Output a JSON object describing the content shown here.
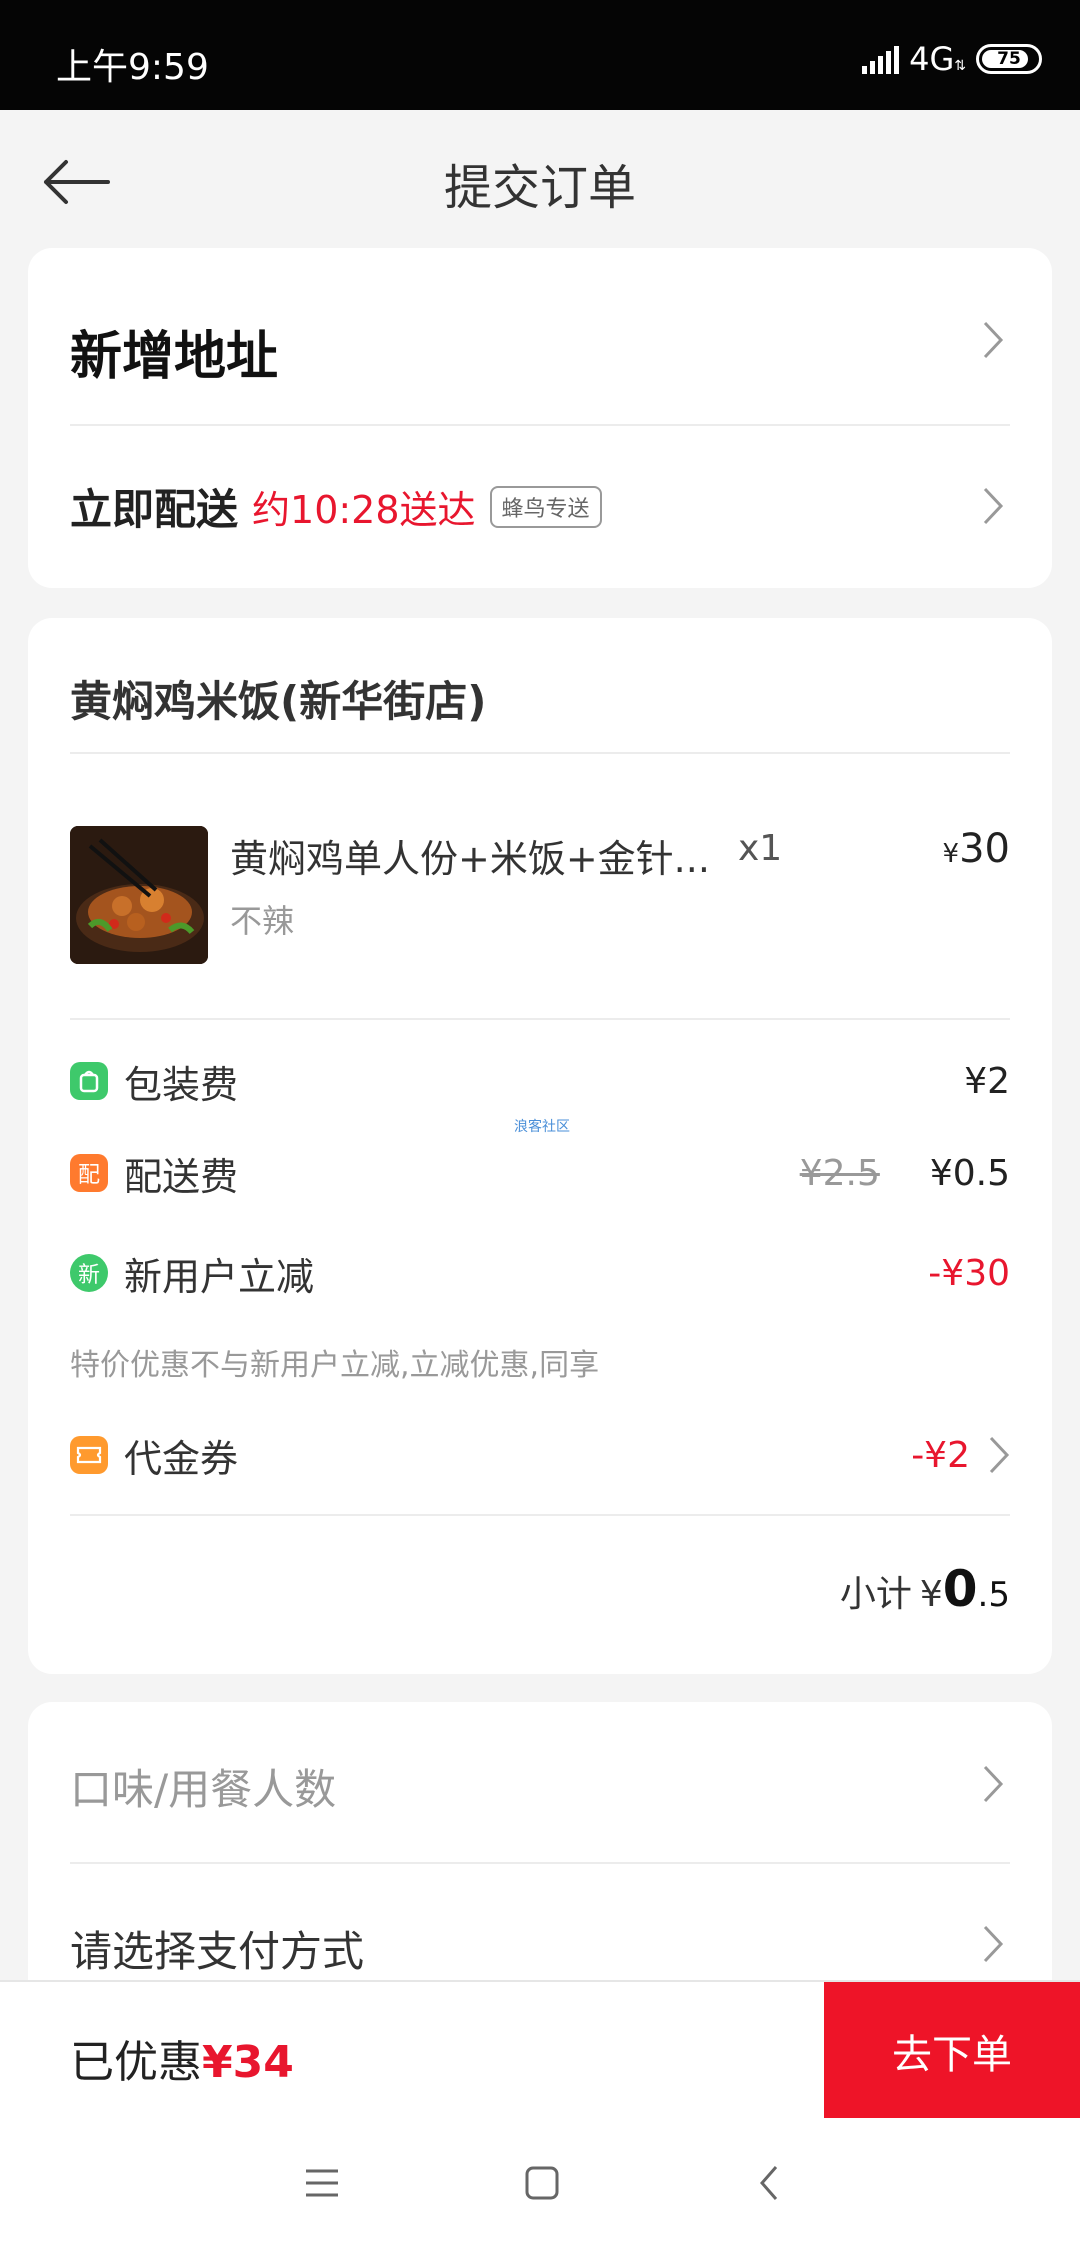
{
  "status_bar": {
    "time": "上午9:59",
    "network": "4G",
    "battery": "75"
  },
  "header": {
    "title": "提交订单"
  },
  "address": {
    "title": "新增地址"
  },
  "delivery": {
    "label": "立即配送",
    "eta": "约10:28送达",
    "tag": "蜂鸟专送"
  },
  "shop": {
    "name": "黄焖鸡米饭(新华街店)"
  },
  "item": {
    "name": "黄焖鸡单人份+米饭+金针...",
    "qty": "x1",
    "currency": "¥",
    "price": "30",
    "spec": "不辣"
  },
  "fees": [
    {
      "icon": "包",
      "label": "包装费",
      "original": "",
      "value": "¥2",
      "color": "#3ec96b"
    },
    {
      "icon": "配",
      "label": "配送费",
      "original": "¥2.5",
      "value": "¥0.5",
      "color": "#ff7a2e"
    },
    {
      "icon": "新",
      "label": "新用户立减",
      "original": "",
      "value": "-¥30",
      "color": "#3ec96b"
    }
  ],
  "promo_note": "特价优惠不与新用户立减,立减优惠,同享",
  "watermark": "浪客社区",
  "voucher": {
    "label": "代金券",
    "value": "-¥2"
  },
  "subtotal": {
    "label": "小计",
    "currency": "¥",
    "int": "0",
    "dec": ".5"
  },
  "options": {
    "taste": "口味/用餐人数",
    "payment": "请选择支付方式"
  },
  "bottom": {
    "saved_label": "已优惠",
    "saved_value": "¥34",
    "submit": "去下单"
  }
}
